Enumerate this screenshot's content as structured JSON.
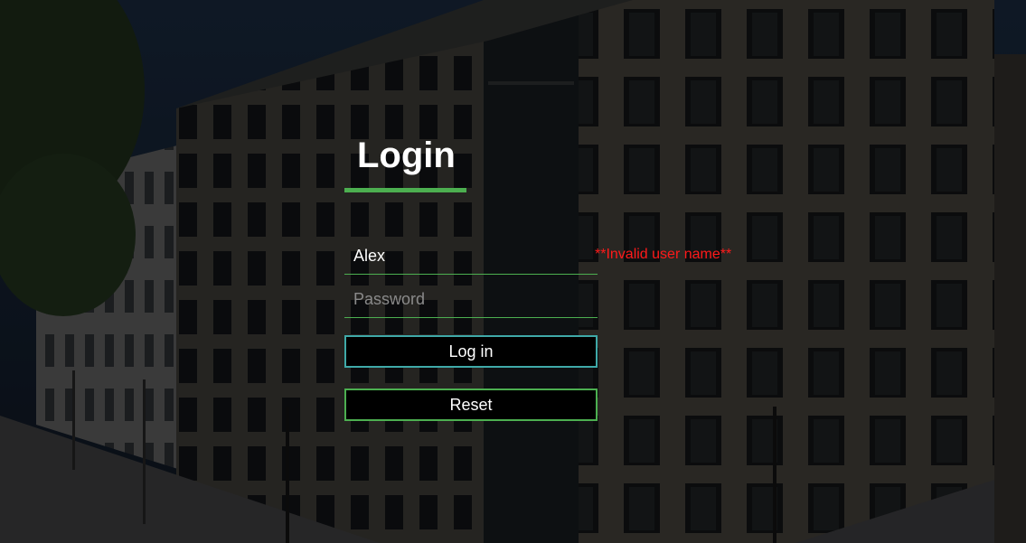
{
  "login": {
    "title": "Login",
    "username_value": "Alex",
    "password_placeholder": "Password",
    "login_button": "Log in",
    "reset_button": "Reset",
    "error_message": "**Invalid user name**"
  },
  "colors": {
    "accent_green": "#4caf50",
    "login_button_border": "#3fa9a8",
    "error_red": "#ff1a1a"
  }
}
